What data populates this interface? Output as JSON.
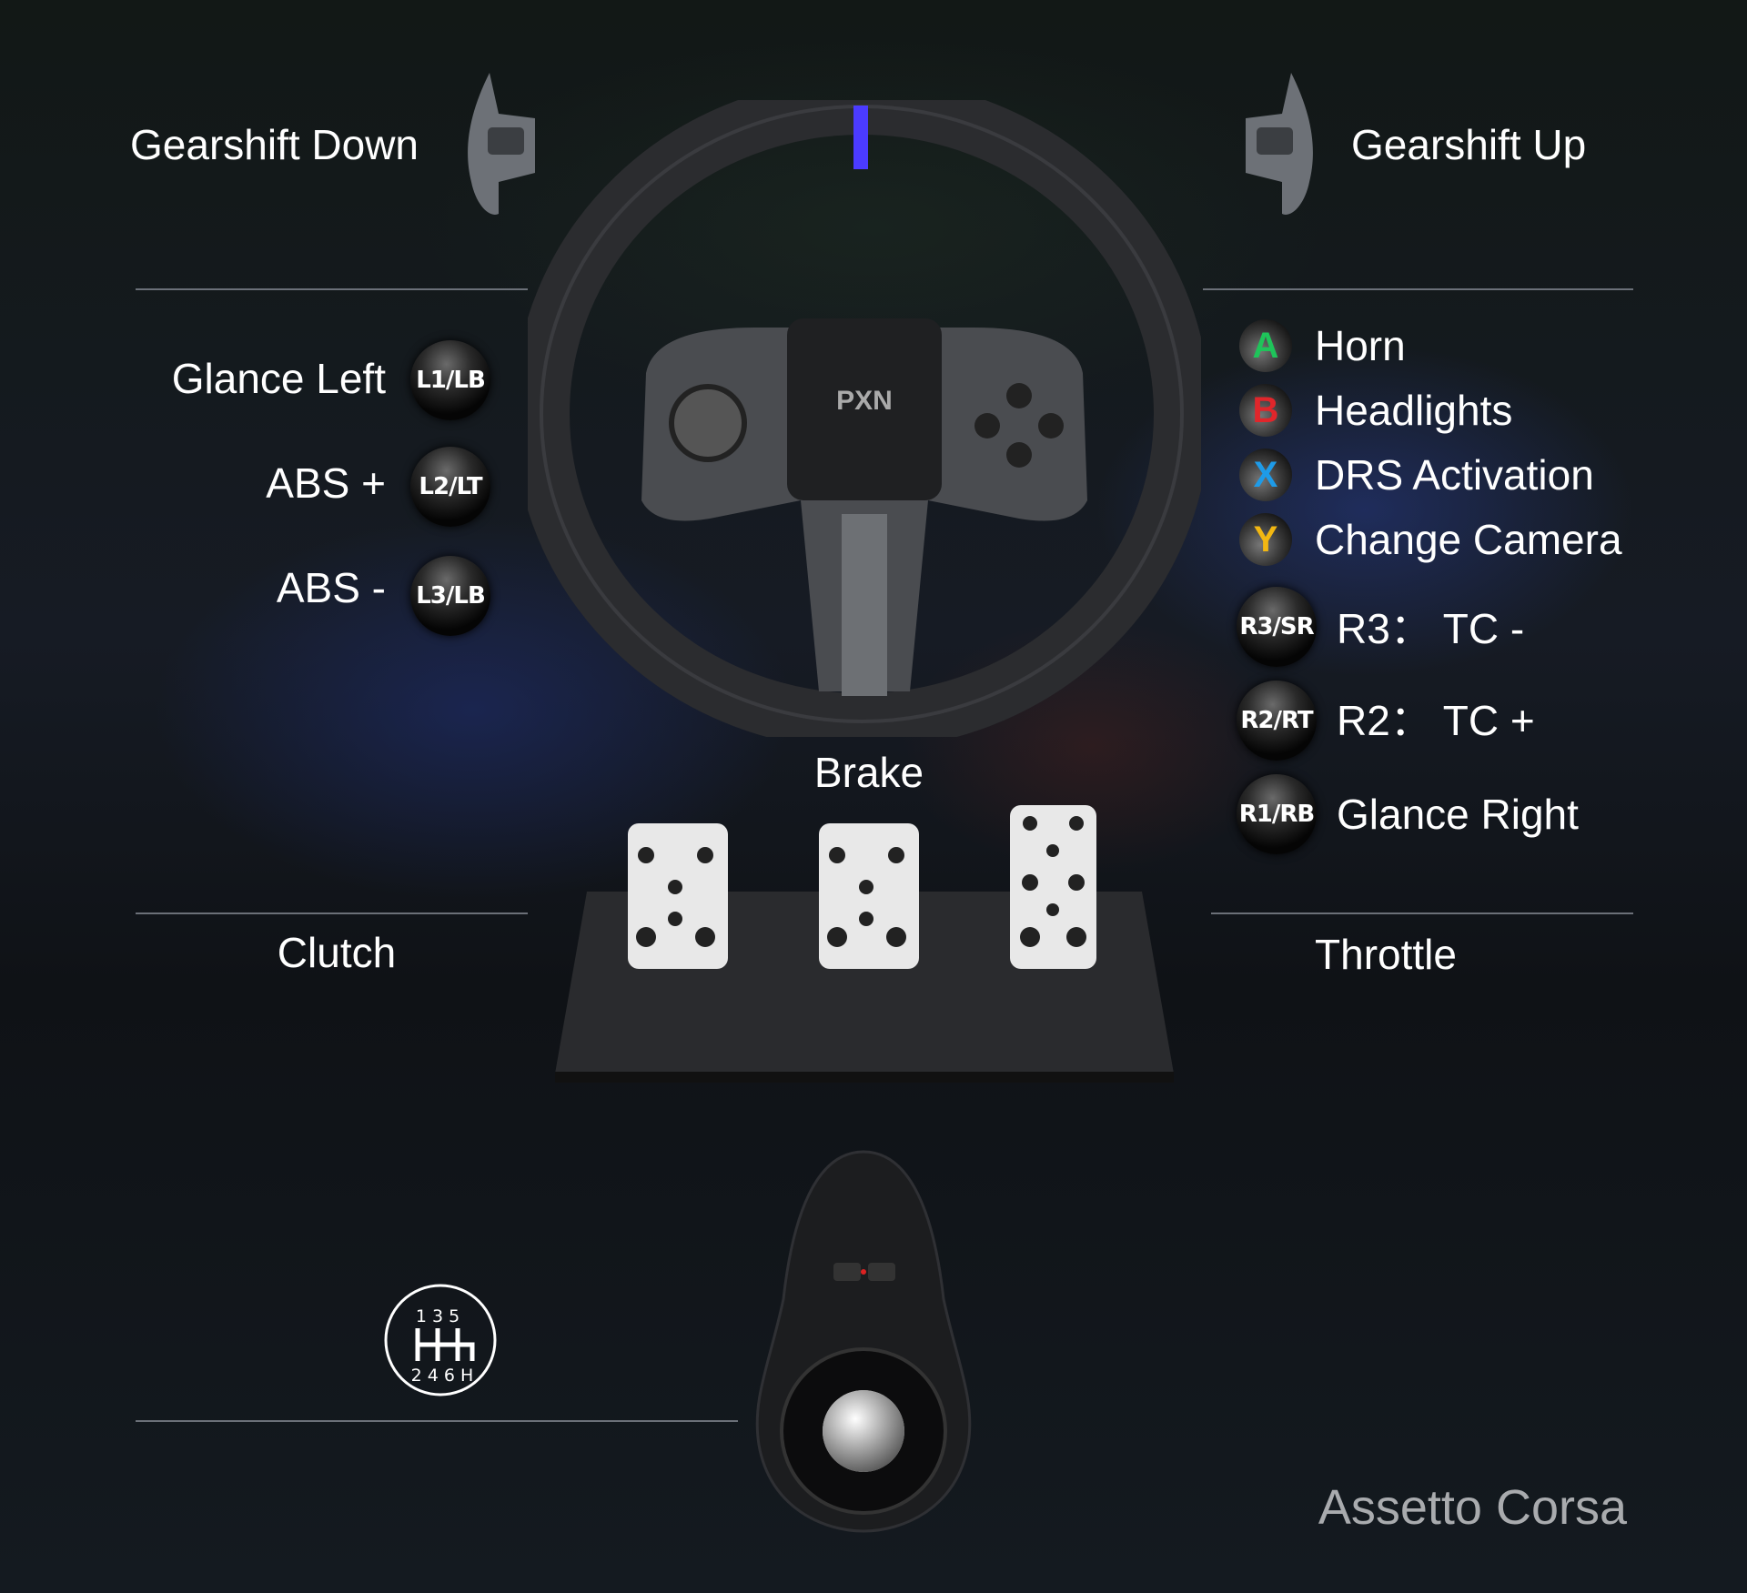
{
  "left": {
    "gearshift_down": "Gearshift Down",
    "items": [
      {
        "label": "Glance Left",
        "button": "L1/LB"
      },
      {
        "label": "ABS +",
        "button": "L2/LT"
      },
      {
        "label": "ABS -",
        "button": "L3/LB"
      }
    ],
    "clutch": "Clutch"
  },
  "right": {
    "gearshift_up": "Gearshift Up",
    "face_buttons": [
      {
        "glyph": "A",
        "label": "Horn",
        "color": "#1fc45a"
      },
      {
        "glyph": "B",
        "label": "Headlights",
        "color": "#e0262b"
      },
      {
        "glyph": "X",
        "label": "DRS Activation",
        "color": "#1e9be8"
      },
      {
        "glyph": "Y",
        "label": "Change Camera",
        "color": "#f2b712"
      }
    ],
    "shoulder_buttons": [
      {
        "button": "R3/SR",
        "label": "R3： TC -"
      },
      {
        "button": "R2/RT",
        "label": "R2： TC +"
      },
      {
        "button": "R1/RB",
        "label": "Glance Right"
      }
    ],
    "throttle": "Throttle"
  },
  "center": {
    "brake": "Brake",
    "brand": "PXN"
  },
  "shifter_icon": {
    "top": "1 3 5",
    "bottom": "2 4 6 H"
  },
  "game_title": "Assetto Corsa",
  "colors": {
    "accent_stripe": "#4b3bff",
    "line": "#6b7078",
    "background": "#111519"
  }
}
